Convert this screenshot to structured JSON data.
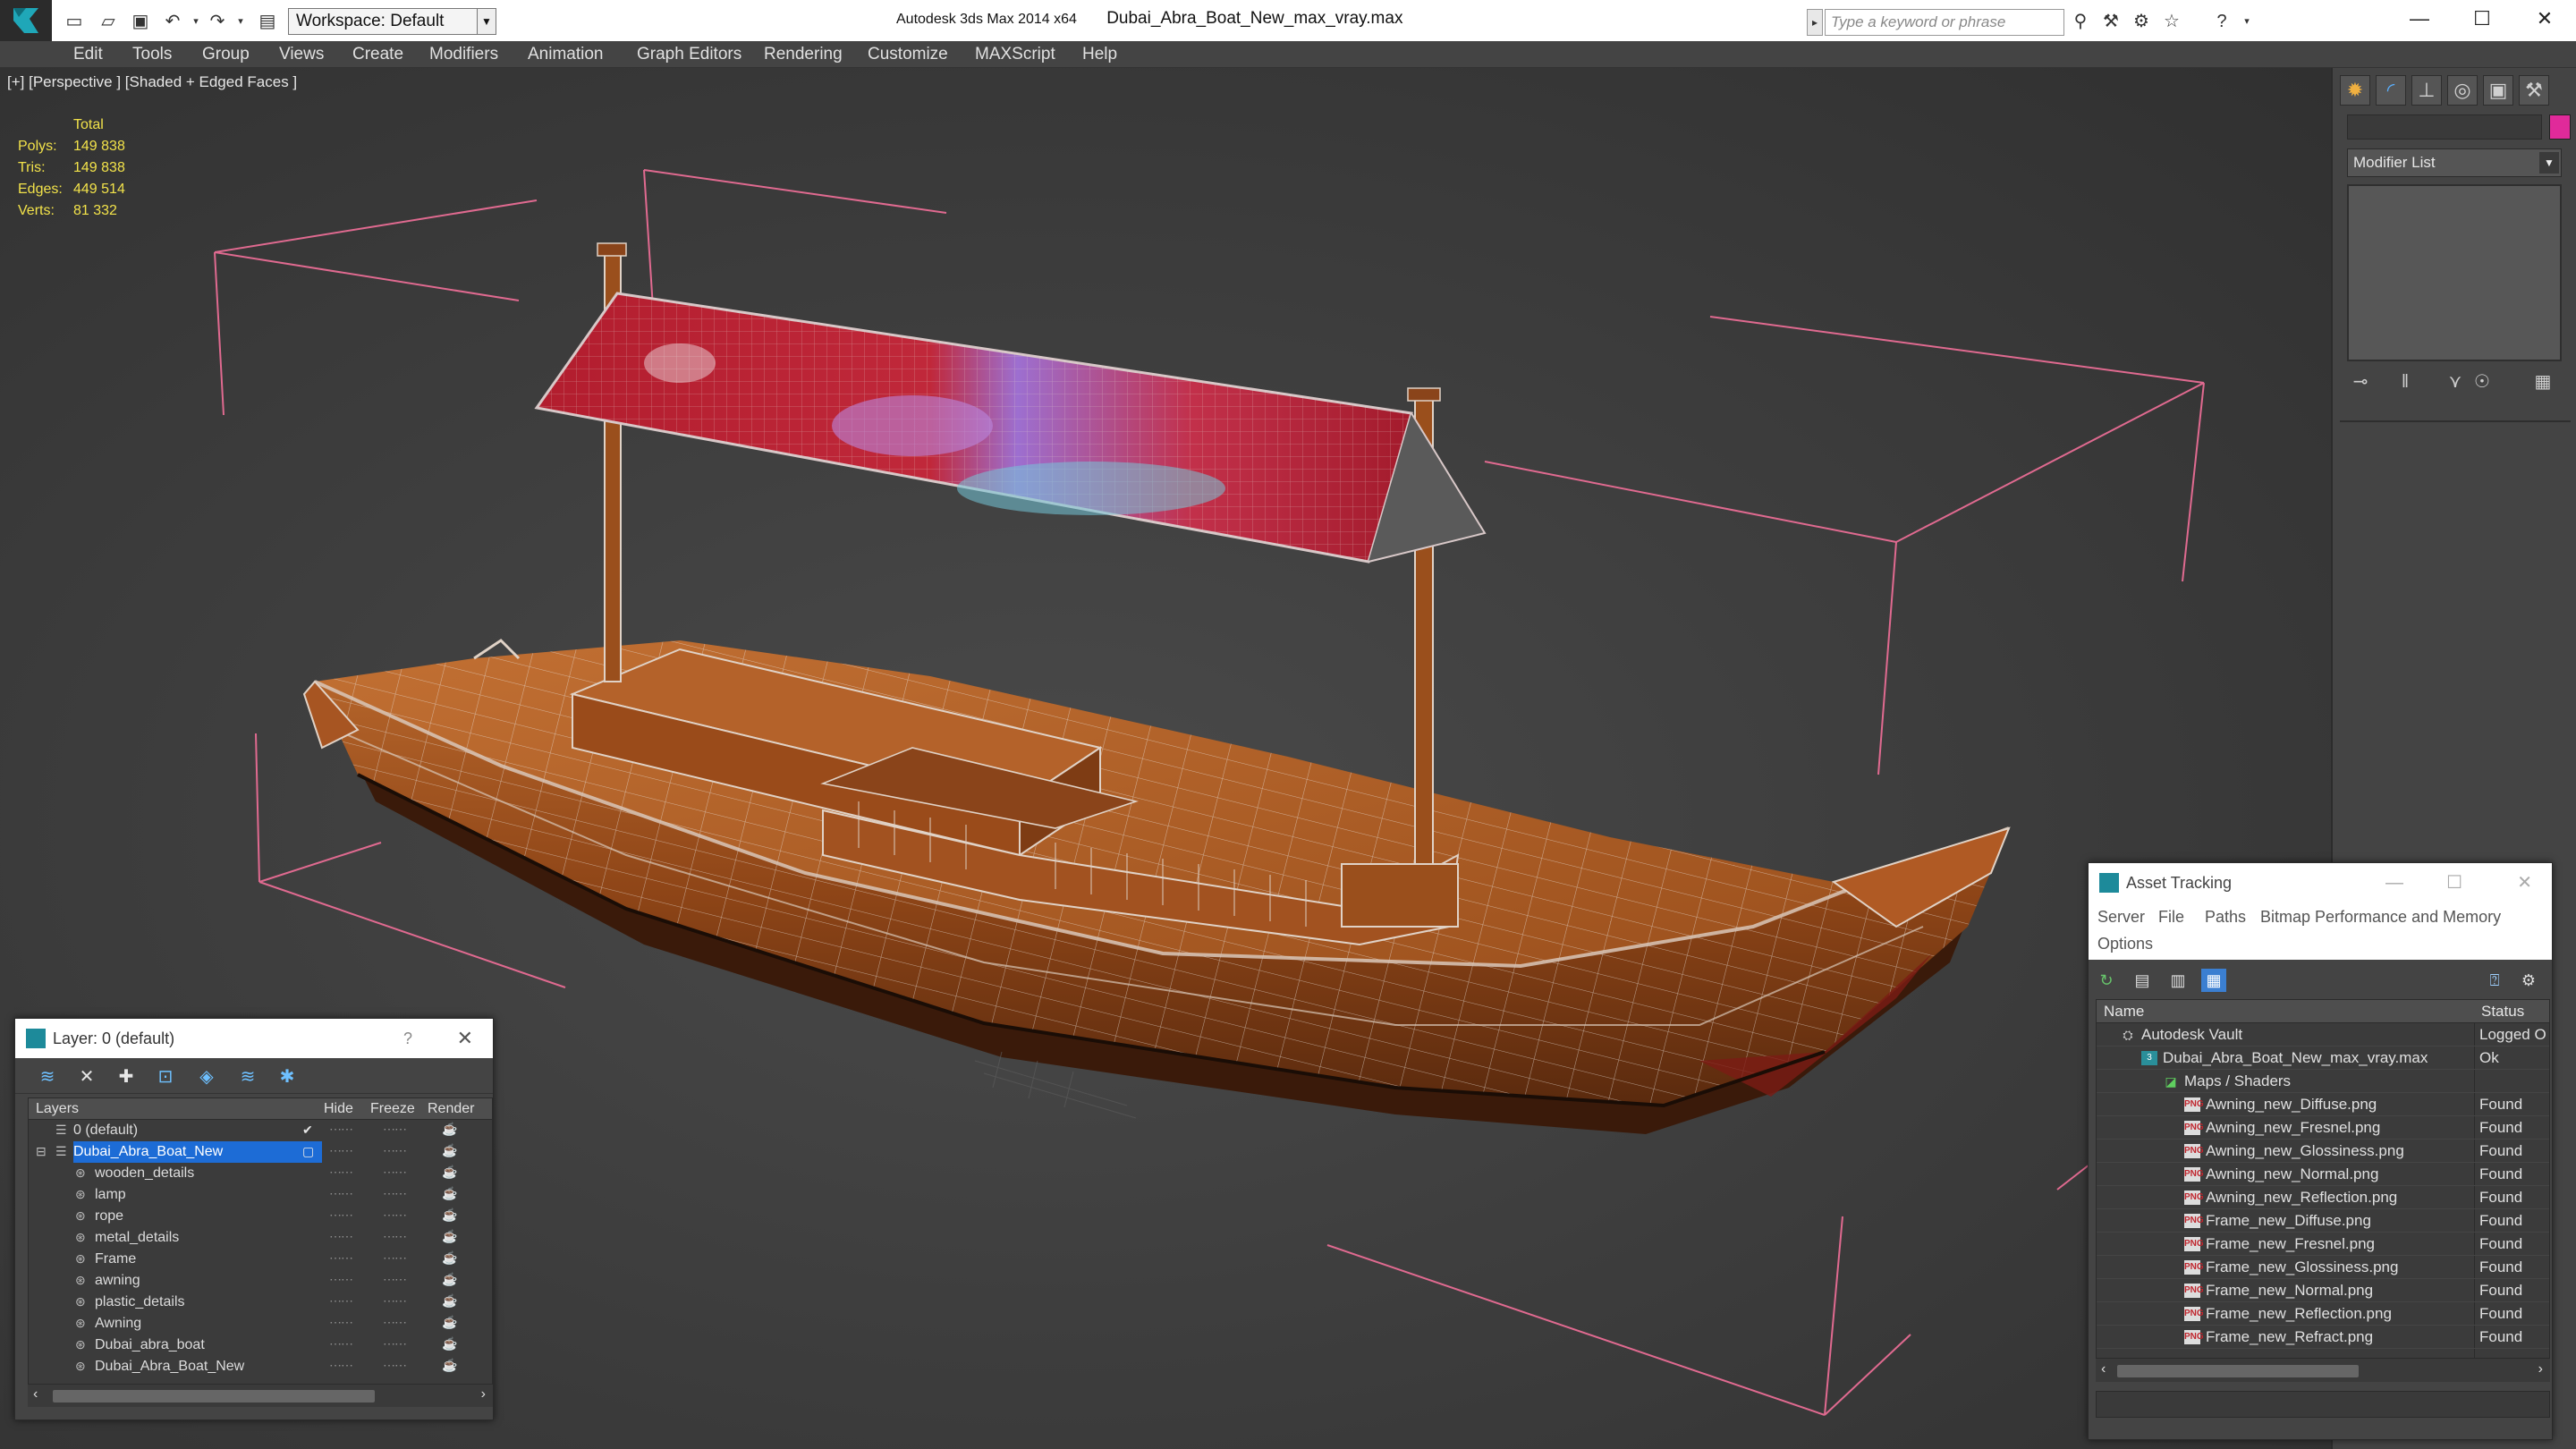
{
  "titlebar": {
    "workspace_label": "Workspace: Default",
    "app_name": "Autodesk 3ds Max  2014 x64",
    "file_name": "Dubai_Abra_Boat_New_max_vray.max",
    "search_placeholder": "Type a keyword or phrase"
  },
  "menubar": {
    "items": [
      "Edit",
      "Tools",
      "Group",
      "Views",
      "Create",
      "Modifiers",
      "Animation",
      "Graph Editors",
      "Rendering",
      "Customize",
      "MAXScript",
      "Help"
    ]
  },
  "viewport": {
    "label": "[+] [Perspective ] [Shaded + Edged Faces ]",
    "stats": {
      "header": "Total",
      "polys_label": "Polys:",
      "polys": "149 838",
      "tris_label": "Tris:",
      "tris": "149 838",
      "edges_label": "Edges:",
      "edges": "449 514",
      "verts_label": "Verts:",
      "verts": "81 332"
    }
  },
  "command_panel": {
    "modifier_list": "Modifier List",
    "object_color": "#e02a9a"
  },
  "layer_window": {
    "title": "Layer: 0 (default)",
    "help": "?",
    "columns": {
      "layers": "Layers",
      "hide": "Hide",
      "freeze": "Freeze",
      "render": "Render"
    },
    "rows": [
      {
        "name": "0 (default)"
      },
      {
        "name": "Dubai_Abra_Boat_New"
      },
      {
        "name": "wooden_details"
      },
      {
        "name": "lamp"
      },
      {
        "name": "rope"
      },
      {
        "name": "metal_details"
      },
      {
        "name": "Frame"
      },
      {
        "name": "awning"
      },
      {
        "name": "plastic_details"
      },
      {
        "name": "Awning"
      },
      {
        "name": "Dubai_abra_boat"
      },
      {
        "name": "Dubai_Abra_Boat_New"
      }
    ]
  },
  "asset_window": {
    "title": "Asset Tracking",
    "menu": [
      "Server",
      "File",
      "Paths",
      "Bitmap Performance and Memory",
      "Options"
    ],
    "columns": {
      "name": "Name",
      "status": "Status"
    },
    "rows": [
      {
        "name": "Autodesk Vault",
        "status": "Logged O"
      },
      {
        "name": "Dubai_Abra_Boat_New_max_vray.max",
        "status": "Ok"
      },
      {
        "name": "Maps / Shaders",
        "status": ""
      },
      {
        "name": "Awning_new_Diffuse.png",
        "status": "Found"
      },
      {
        "name": "Awning_new_Fresnel.png",
        "status": "Found"
      },
      {
        "name": "Awning_new_Glossiness.png",
        "status": "Found"
      },
      {
        "name": "Awning_new_Normal.png",
        "status": "Found"
      },
      {
        "name": "Awning_new_Reflection.png",
        "status": "Found"
      },
      {
        "name": "Frame_new_Diffuse.png",
        "status": "Found"
      },
      {
        "name": "Frame_new_Fresnel.png",
        "status": "Found"
      },
      {
        "name": "Frame_new_Glossiness.png",
        "status": "Found"
      },
      {
        "name": "Frame_new_Normal.png",
        "status": "Found"
      },
      {
        "name": "Frame_new_Reflection.png",
        "status": "Found"
      },
      {
        "name": "Frame_new_Refract.png",
        "status": "Found"
      }
    ]
  }
}
